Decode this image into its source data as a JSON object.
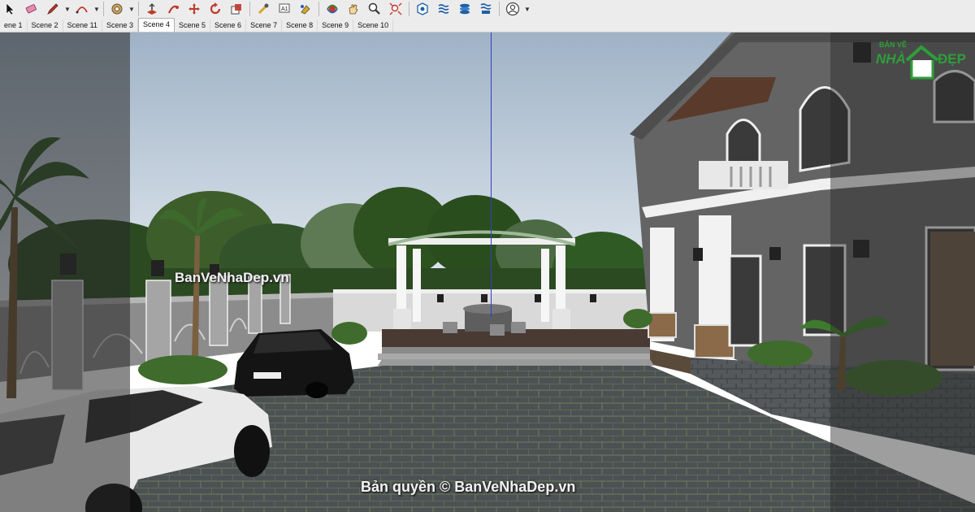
{
  "toolbar": {
    "icons": [
      "select-icon",
      "eraser-icon",
      "pencil-icon",
      "arc-icon",
      "paint-bucket-icon",
      "push-pull-icon",
      "follow-me-icon",
      "move-icon",
      "rotate-icon",
      "scale-icon",
      "tape-measure-icon",
      "text-icon",
      "paint-icon",
      "orbit-icon",
      "pan-icon",
      "zoom-icon",
      "zoom-extents-icon",
      "sandbox-icon",
      "layers-icon",
      "styles-icon",
      "component-icon",
      "user-icon"
    ]
  },
  "scene_tabs": [
    "ene 1",
    "Scene 2",
    "Scene 11",
    "Scene 3",
    "Scene 4",
    "Scene 5",
    "Scene 6",
    "Scene 7",
    "Scene 8",
    "Scene 9",
    "Scene 10"
  ],
  "active_tab": "Scene 4",
  "watermarks": {
    "center": "BanVeNhaDep.vn",
    "bottom": "Bản quyền © BanVeNhaDep.vn"
  },
  "logo": {
    "top": "BẢN VẼ",
    "left": "NHÀ",
    "right": "ĐẸP"
  },
  "colors": {
    "sky_top": "#9fb2c6",
    "sky_bottom": "#dde6ee",
    "wall": "#8a8a8a",
    "paving": "#4a4f52",
    "foliage": "#2f5a24",
    "logo_green": "#2e9e3a"
  }
}
